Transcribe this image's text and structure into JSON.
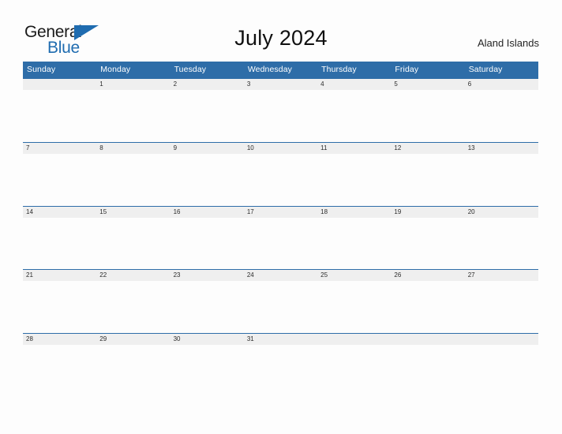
{
  "brand": {
    "name_dark": "General",
    "name_blue": "Blue",
    "triangle_color": "#1f6cb0"
  },
  "header": {
    "title": "July 2024",
    "locale": "Aland Islands"
  },
  "theme": {
    "header_blue": "#2e6da8",
    "row_strip_gray": "#efefef",
    "page_background": "#fdfdfd",
    "text_dark": "#2b2b2b"
  },
  "calendar": {
    "month": "July",
    "year": "2024",
    "weekday_headers": [
      "Sunday",
      "Monday",
      "Tuesday",
      "Wednesday",
      "Thursday",
      "Friday",
      "Saturday"
    ],
    "weeks": [
      {
        "days": [
          "",
          "1",
          "2",
          "3",
          "4",
          "5",
          "6"
        ]
      },
      {
        "days": [
          "7",
          "8",
          "9",
          "10",
          "11",
          "12",
          "13"
        ]
      },
      {
        "days": [
          "14",
          "15",
          "16",
          "17",
          "18",
          "19",
          "20"
        ]
      },
      {
        "days": [
          "21",
          "22",
          "23",
          "24",
          "25",
          "26",
          "27"
        ]
      },
      {
        "days": [
          "28",
          "29",
          "30",
          "31",
          "",
          "",
          ""
        ]
      }
    ],
    "events": [
      {
        "week": 0,
        "day": 0,
        "text": ""
      },
      {
        "week": 0,
        "day": 1,
        "text": ""
      },
      {
        "week": 0,
        "day": 2,
        "text": ""
      },
      {
        "week": 0,
        "day": 3,
        "text": ""
      },
      {
        "week": 0,
        "day": 4,
        "text": ""
      },
      {
        "week": 0,
        "day": 5,
        "text": ""
      },
      {
        "week": 0,
        "day": 6,
        "text": ""
      },
      {
        "week": 1,
        "day": 0,
        "text": ""
      },
      {
        "week": 1,
        "day": 1,
        "text": ""
      },
      {
        "week": 1,
        "day": 2,
        "text": ""
      },
      {
        "week": 1,
        "day": 3,
        "text": ""
      },
      {
        "week": 1,
        "day": 4,
        "text": ""
      },
      {
        "week": 1,
        "day": 5,
        "text": ""
      },
      {
        "week": 1,
        "day": 6,
        "text": ""
      },
      {
        "week": 2,
        "day": 0,
        "text": ""
      },
      {
        "week": 2,
        "day": 1,
        "text": ""
      },
      {
        "week": 2,
        "day": 2,
        "text": ""
      },
      {
        "week": 2,
        "day": 3,
        "text": ""
      },
      {
        "week": 2,
        "day": 4,
        "text": ""
      },
      {
        "week": 2,
        "day": 5,
        "text": ""
      },
      {
        "week": 2,
        "day": 6,
        "text": ""
      },
      {
        "week": 3,
        "day": 0,
        "text": ""
      },
      {
        "week": 3,
        "day": 1,
        "text": ""
      },
      {
        "week": 3,
        "day": 2,
        "text": ""
      },
      {
        "week": 3,
        "day": 3,
        "text": ""
      },
      {
        "week": 3,
        "day": 4,
        "text": ""
      },
      {
        "week": 3,
        "day": 5,
        "text": ""
      },
      {
        "week": 3,
        "day": 6,
        "text": ""
      },
      {
        "week": 4,
        "day": 0,
        "text": ""
      },
      {
        "week": 4,
        "day": 1,
        "text": ""
      },
      {
        "week": 4,
        "day": 2,
        "text": ""
      },
      {
        "week": 4,
        "day": 3,
        "text": ""
      },
      {
        "week": 4,
        "day": 4,
        "text": ""
      },
      {
        "week": 4,
        "day": 5,
        "text": ""
      },
      {
        "week": 4,
        "day": 6,
        "text": ""
      }
    ]
  }
}
